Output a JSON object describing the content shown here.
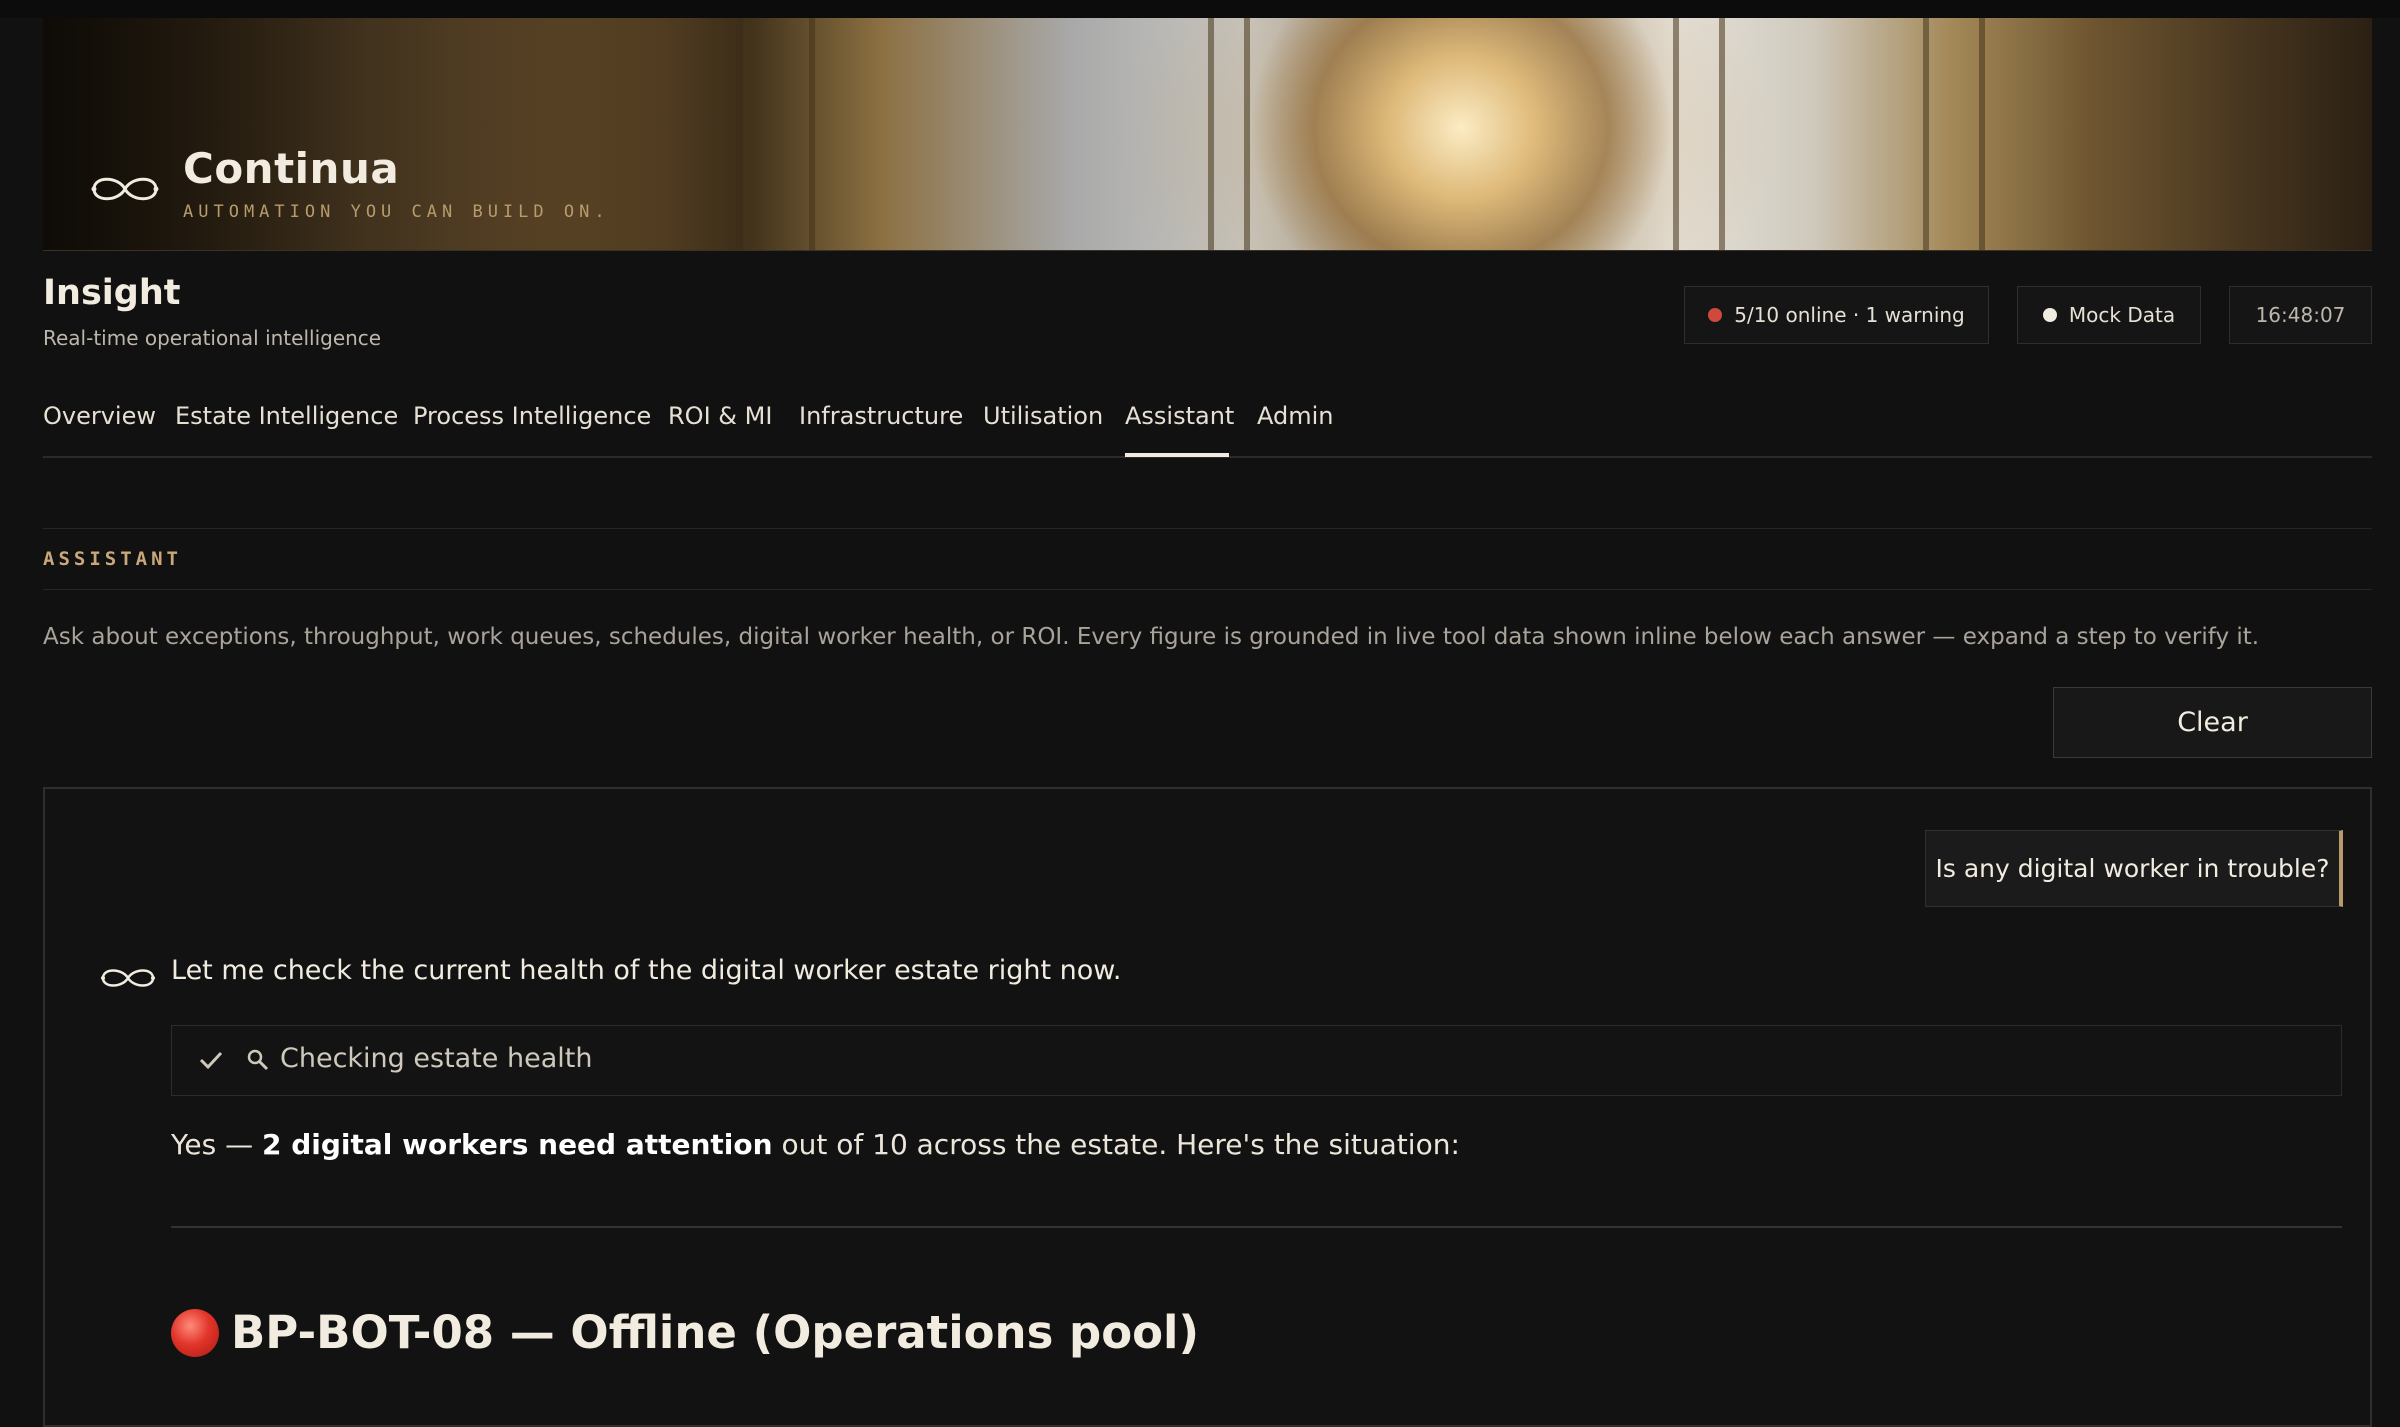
{
  "brand": {
    "name": "Continua",
    "tagline": "AUTOMATION YOU CAN BUILD ON."
  },
  "header": {
    "title": "Insight",
    "subtitle": "Real-time operational intelligence"
  },
  "status": {
    "online_text": "5/10 online · 1 warning",
    "online_dot_color": "#d04a3c",
    "data_source": "Mock Data",
    "data_dot_color": "#f2ece0",
    "clock": "16:48:07"
  },
  "tabs": [
    {
      "label": "Overview"
    },
    {
      "label": "Estate Intelligence"
    },
    {
      "label": "Process Intelligence"
    },
    {
      "label": "ROI & MI"
    },
    {
      "label": "Infrastructure"
    },
    {
      "label": "Utilisation"
    },
    {
      "label": "Assistant",
      "active": true
    },
    {
      "label": "Admin"
    }
  ],
  "assistant": {
    "section_label": "ASSISTANT",
    "description": "Ask about exceptions, throughput, work queues, schedules, digital worker health, or ROI. Every figure is grounded in live tool data shown inline below each answer — expand a step to verify it.",
    "clear_label": "Clear",
    "user_message": "Is any digital worker in trouble?",
    "intro": "Let me check the current health of the digital worker estate right now.",
    "tool_step": {
      "icon": "search-icon",
      "label": "Checking estate health",
      "status": "complete"
    },
    "answer": {
      "prefix": "Yes — ",
      "bold": "2 digital workers need attention",
      "suffix": " out of 10 across the estate. Here's the situation:"
    },
    "finding_heading": "BP-BOT-08 — Offline (Operations pool)"
  },
  "colors": {
    "accent": "#b89b6c",
    "background": "#111111",
    "text": "#f2ece0"
  }
}
